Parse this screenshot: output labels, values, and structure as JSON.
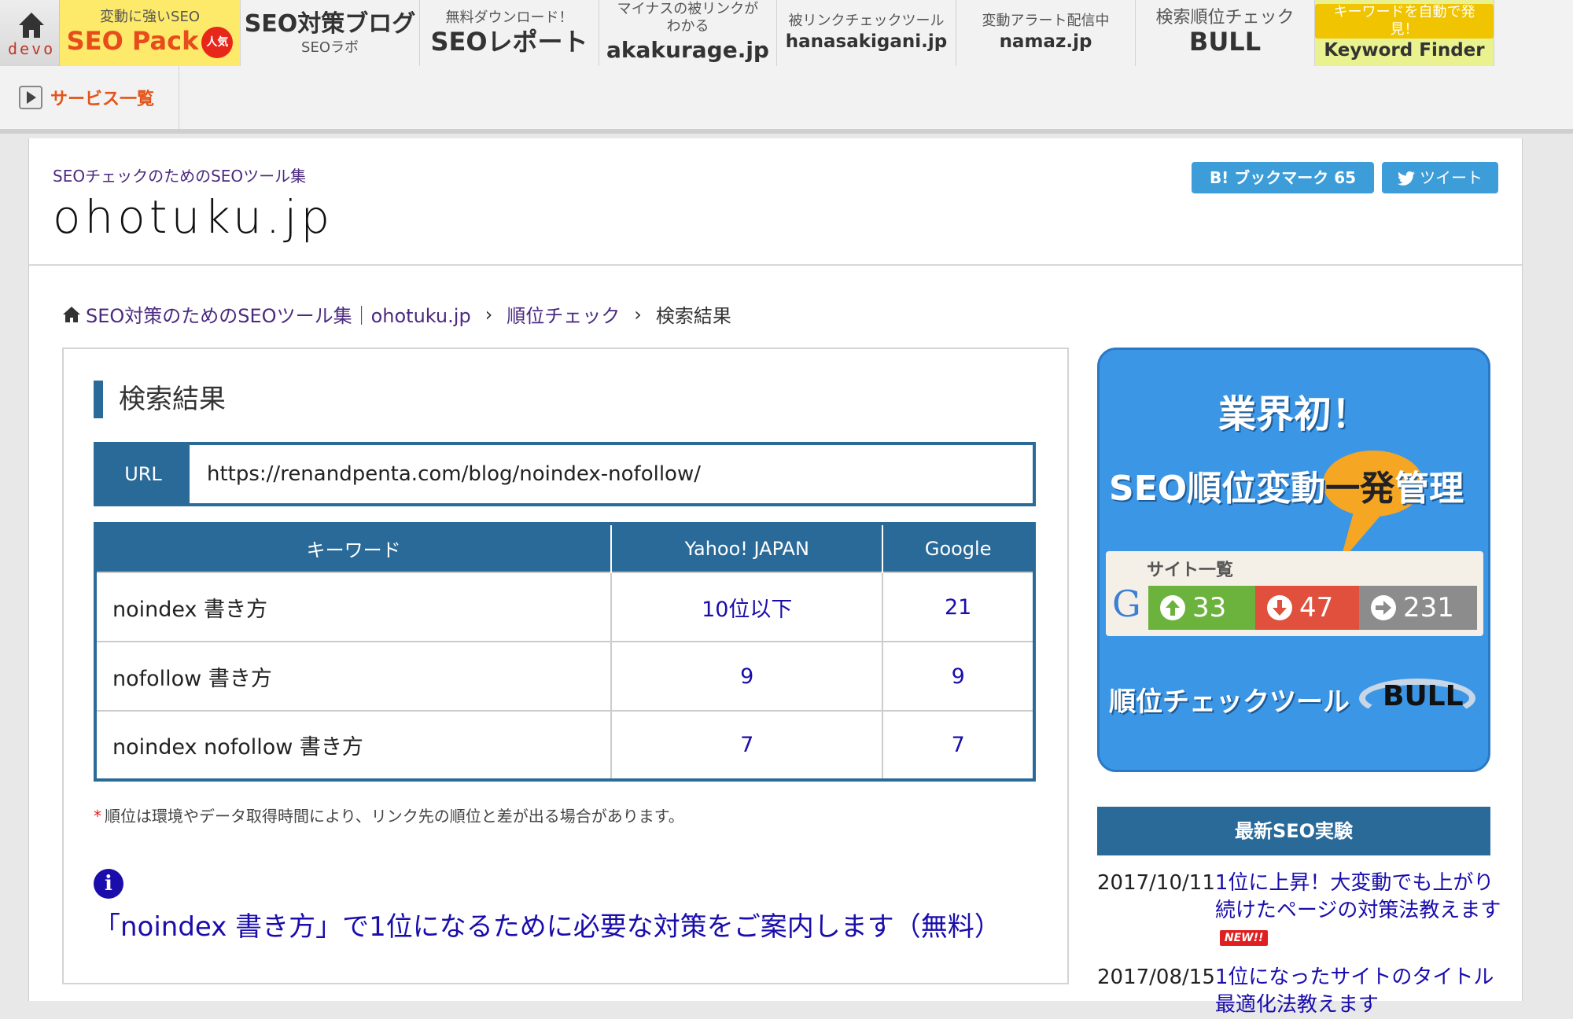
{
  "topbar": {
    "home_label": "devo",
    "items": [
      {
        "small": "変動に強いSEO",
        "big": "SEO Pack",
        "badge": "人気"
      },
      {
        "big": "SEO対策ブログ",
        "small": "SEOラボ"
      },
      {
        "small": "無料ダウンロード！",
        "big": "SEOレポート"
      },
      {
        "small": "マイナスの被リンクが わかる",
        "big": "akakurage.jp"
      },
      {
        "small": "被リンクチェックツール",
        "mid": "hanasakigani.jp"
      },
      {
        "small": "変動アラート配信中",
        "mid": "namaz.jp"
      },
      {
        "small": "検索順位チェック",
        "big": "BULL"
      },
      {
        "small": "キーワードを自動で発見！",
        "mid": "Keyword Finder"
      }
    ],
    "service_list": "サービス一覧"
  },
  "header": {
    "tagline": "SEOチェックのためのSEOツール集",
    "logo": "ohotuku.jp",
    "bookmark": "B! ブックマーク 65",
    "tweet": "ツイート"
  },
  "breadcrumb": {
    "home": "SEO対策のためのSEOツール集｜ohotuku.jp",
    "level2": "順位チェック",
    "current": "検索結果",
    "sep": "›"
  },
  "result": {
    "title": "検索結果",
    "url_label": "URL",
    "url_value": "https://renandpenta.com/blog/noindex-nofollow/",
    "columns": [
      "キーワード",
      "Yahoo! JAPAN",
      "Google"
    ],
    "rows": [
      {
        "keyword": "noindex 書き方",
        "yahoo": "10位以下",
        "google": "21"
      },
      {
        "keyword": "nofollow 書き方",
        "yahoo": "9",
        "google": "9"
      },
      {
        "keyword": "noindex nofollow 書き方",
        "yahoo": "7",
        "google": "7"
      }
    ],
    "note": "順位は環境やデータ取得時間により、リンク先の順位と差が出る場合があります。",
    "info_link": "「noindex 書き方」で1位になるために必要な対策をご案内します（無料）"
  },
  "banner": {
    "line1": "業界初！",
    "line2_a": "SEO順位変動",
    "line2_hl": "一発",
    "line2_b": "管理",
    "panel_caption": "サイト一覧",
    "g": "G",
    "up": "33",
    "down": "47",
    "right": "231",
    "line3": "順位チェックツール",
    "brand": "BULL"
  },
  "latest": {
    "heading": "最新SEO実験",
    "items": [
      {
        "date": "2017/10/11",
        "title": "1位に上昇！大変動でも上がり続けたページの対策法教えます",
        "badge": "NEW!!"
      },
      {
        "date": "2017/08/15",
        "title": "1位になったサイトのタイトル最適化法教えます"
      }
    ]
  },
  "colors": {
    "accent": "#2a6a99",
    "link": "#1a0dab",
    "seopack_bg": "#fde96a"
  }
}
